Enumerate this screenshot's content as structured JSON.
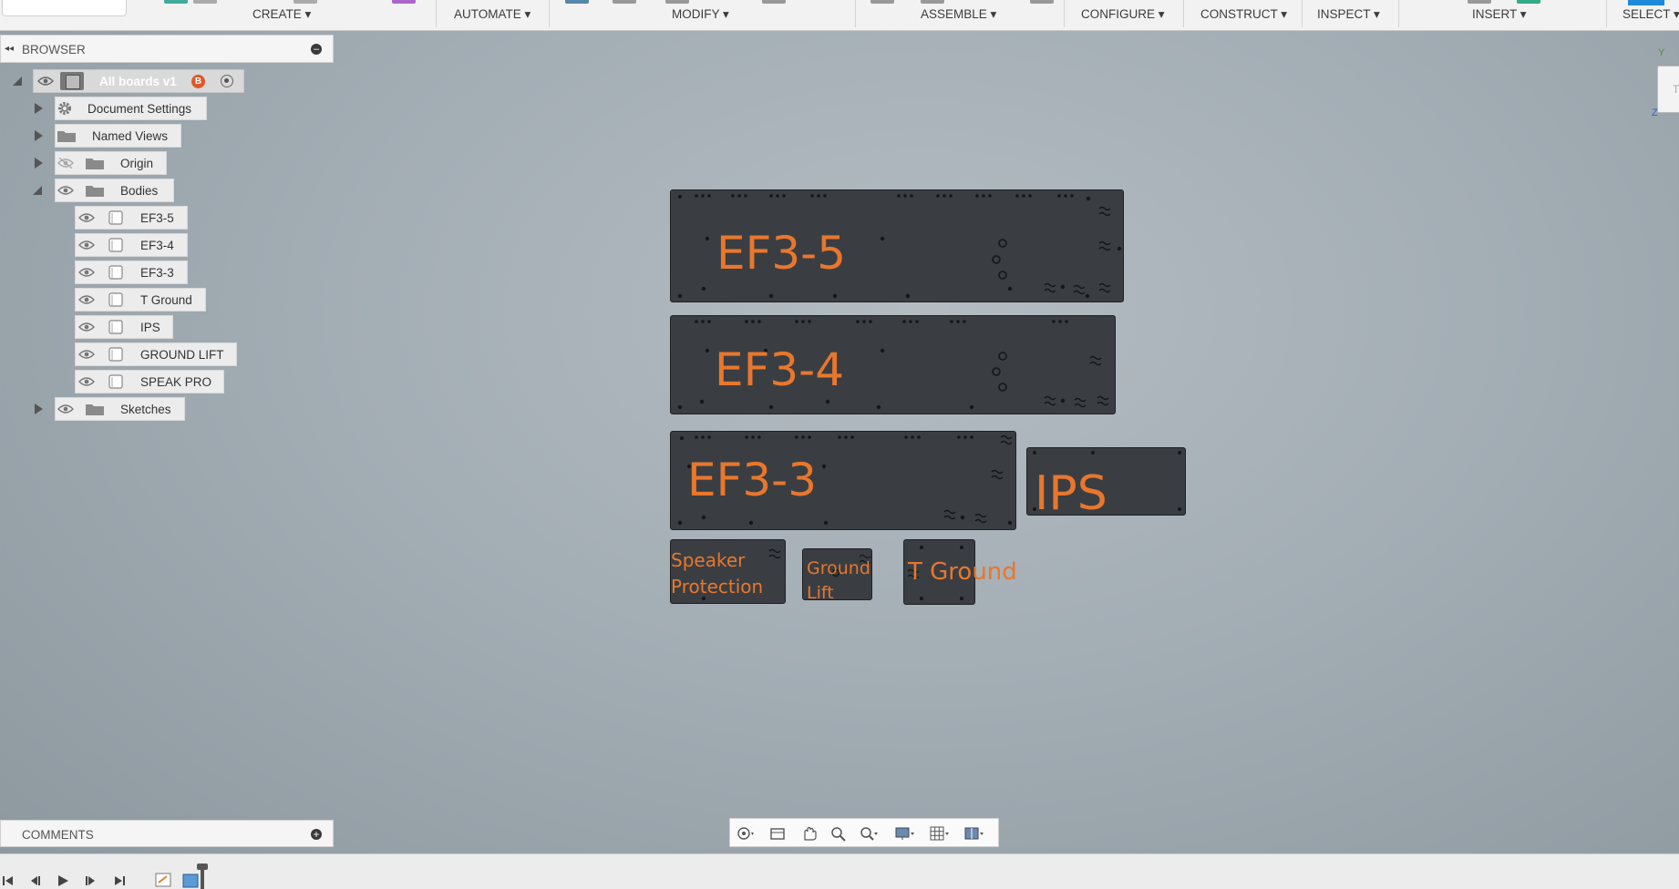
{
  "toolbar": {
    "menus": [
      "CREATE ▾",
      "AUTOMATE ▾",
      "MODIFY ▾",
      "ASSEMBLE ▾",
      "CONFIGURE ▾",
      "CONSTRUCT ▾",
      "INSPECT ▾",
      "INSERT ▾",
      "SELECT ▾"
    ]
  },
  "browser": {
    "title": "BROWSER",
    "root_label": "All boards v1",
    "root_badge": "B",
    "items": {
      "document_settings": "Document Settings",
      "named_views": "Named Views",
      "origin": "Origin",
      "bodies": "Bodies",
      "sketches": "Sketches"
    },
    "bodies": [
      "EF3-5",
      "EF3-4",
      "EF3-3",
      "T Ground",
      "IPS",
      "GROUND LIFT",
      "SPEAK PRO"
    ]
  },
  "canvas": {
    "labels": {
      "ef35": "EF3-5",
      "ef34": "EF3-4",
      "ef33": "EF3-3",
      "ips": "IPS",
      "speaker_line1": "Speaker",
      "speaker_line2": "Protection",
      "ground_lift_line1": "Ground",
      "ground_lift_line2": "Lift",
      "t_ground": "T Ground"
    },
    "viewcube_text": "TC",
    "axis_y": "Y",
    "axis_z": "Z"
  },
  "comments": {
    "title": "COMMENTS"
  },
  "colors": {
    "board_fill": "#3a3e42",
    "label_orange": "#e8772d",
    "accent_blue": "#1d8ad8"
  },
  "icons": {
    "visibility": "eye-icon",
    "folder": "folder-icon",
    "body": "cube-icon",
    "settings": "gear-icon"
  }
}
